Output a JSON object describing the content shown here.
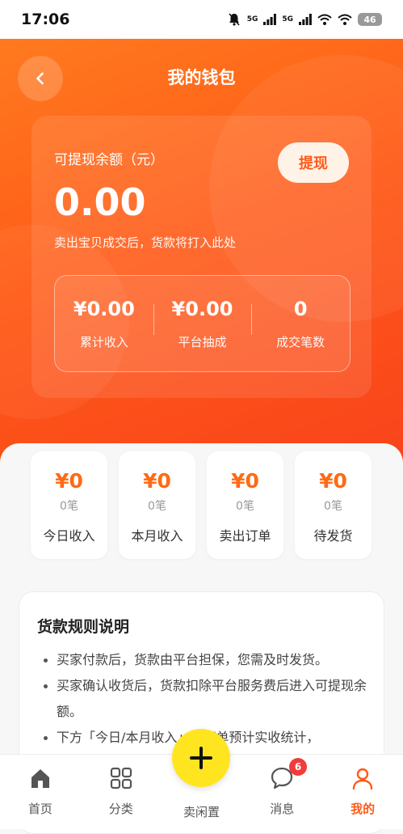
{
  "status_bar": {
    "time": "17:06",
    "net1": "5G",
    "net2": "5G",
    "battery": "46"
  },
  "header": {
    "title": "我的钱包"
  },
  "balance": {
    "label": "可提现余额（元）",
    "amount": "0.00",
    "note": "卖出宝贝成交后，货款将打入此处",
    "withdraw_label": "提现"
  },
  "summary_stats": [
    {
      "value": "¥0.00",
      "label": "累计收入"
    },
    {
      "value": "¥0.00",
      "label": "平台抽成"
    },
    {
      "value": "0",
      "label": "成交笔数"
    }
  ],
  "mini_cards": [
    {
      "amount": "¥0",
      "count": "0笔",
      "label": "今日收入"
    },
    {
      "amount": "¥0",
      "count": "0笔",
      "label": "本月收入"
    },
    {
      "amount": "¥0",
      "count": "0笔",
      "label": "卖出订单"
    },
    {
      "amount": "¥0",
      "count": "0笔",
      "label": "待发货"
    }
  ],
  "rules": {
    "title": "货款规则说明",
    "items": [
      "买家付款后，货款由平台担保，您需及时发货。",
      "买家确认收货后，货款扣除平台服务费后进入可提现余额。",
      "下方「今日/本月收入」为订单预计实收统计，"
    ]
  },
  "tab_bar": {
    "items": [
      {
        "label": "首页"
      },
      {
        "label": "分类"
      },
      {
        "label": "卖闲置"
      },
      {
        "label": "消息"
      },
      {
        "label": "我的"
      }
    ],
    "message_badge": "6",
    "active_color": "#ff5a17"
  },
  "colors": {
    "accent": "#ff5a17",
    "fab": "#ffe51f",
    "badge": "#f23b3b"
  }
}
